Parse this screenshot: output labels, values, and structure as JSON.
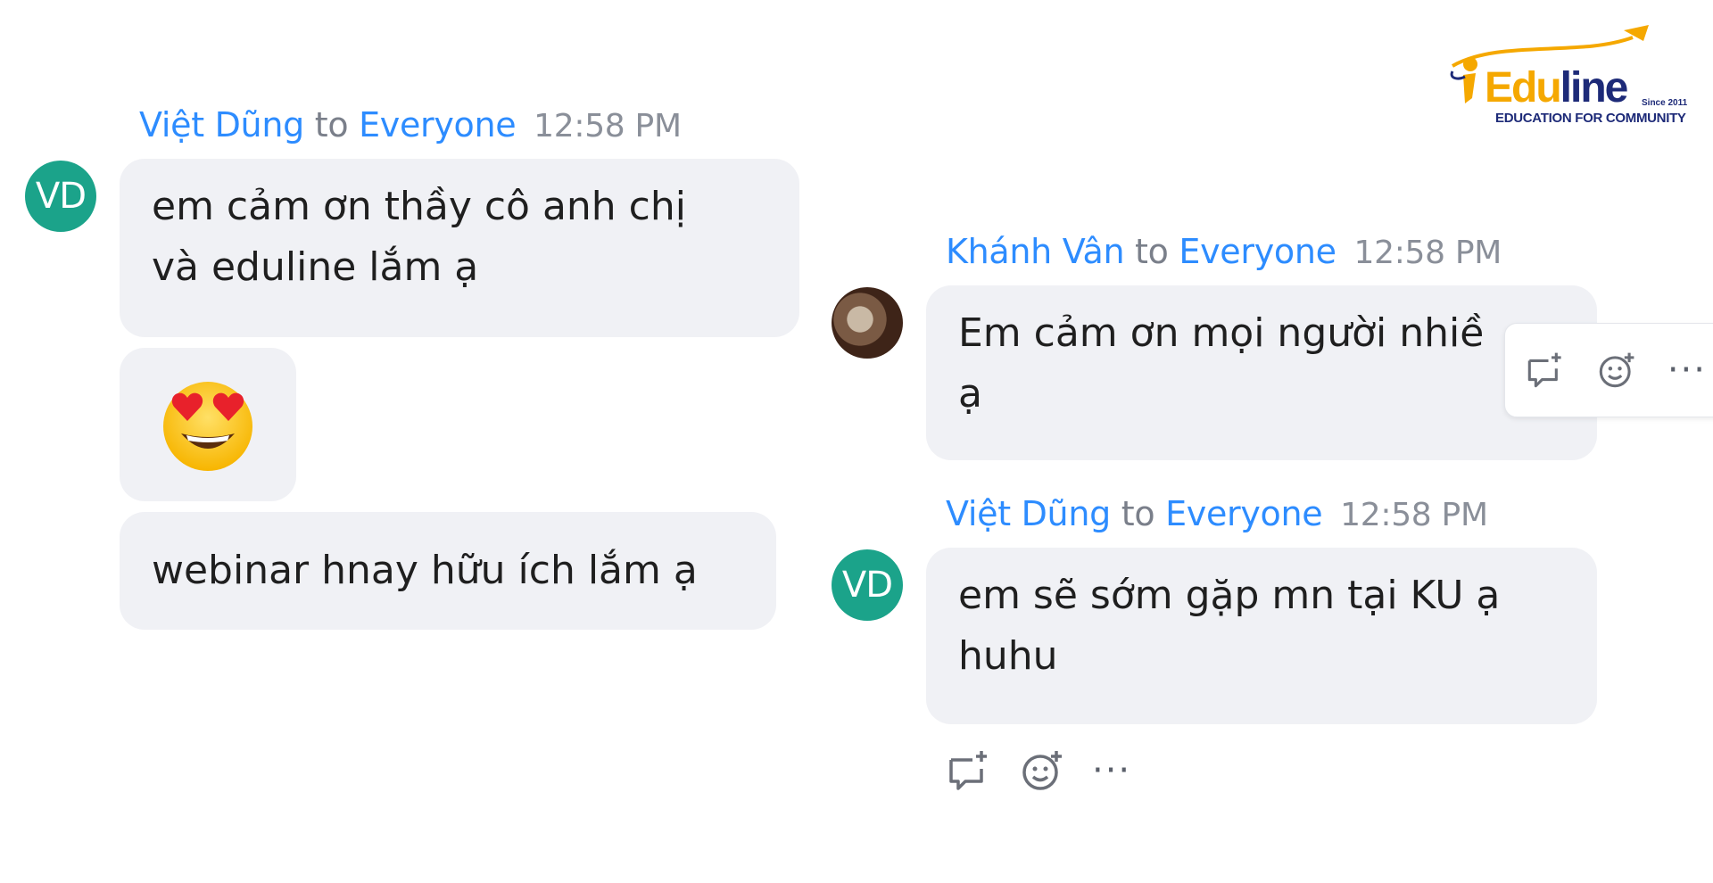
{
  "logo": {
    "brand_edu": "Edu",
    "brand_line": "line",
    "since": "Since 2011",
    "tagline": "EDUCATION FOR COMMUNITY"
  },
  "messages": [
    {
      "sender": "Việt Dũng",
      "to": "to",
      "recipient": "Everyone",
      "time": "12:58 PM",
      "avatar_initials": "VD",
      "bubbles": [
        {
          "lines": [
            "em cảm ơn thầy cô anh chị",
            "và eduline lắm ạ"
          ]
        },
        {
          "emoji": "😍",
          "emoji_name": "smiling-face-with-heart-eyes"
        },
        {
          "lines": [
            "webinar hnay hữu ích lắm ạ"
          ]
        }
      ]
    },
    {
      "sender": "Khánh Vân",
      "to": "to",
      "recipient": "Everyone",
      "time": "12:58 PM",
      "avatar_initials": "",
      "bubbles": [
        {
          "lines": [
            "Em cảm ơn mọi người nhiề",
            "ạ"
          ]
        }
      ]
    },
    {
      "sender": "Việt Dũng",
      "to": "to",
      "recipient": "Everyone",
      "time": "12:58 PM",
      "avatar_initials": "VD",
      "bubbles": [
        {
          "lines": [
            "em sẽ sớm gặp mn tại KU ạ",
            "huhu"
          ]
        }
      ]
    }
  ],
  "actions": {
    "reply_icon": "reply-comment-plus-icon",
    "react_icon": "add-reaction-icon",
    "more_label": "···"
  },
  "colors": {
    "accent": "#2D8CFF",
    "avatar_bg": "#1BA38A",
    "bubble_bg": "#f0f1f5",
    "logo_orange": "#F5A800",
    "logo_navy": "#1d2a78"
  }
}
